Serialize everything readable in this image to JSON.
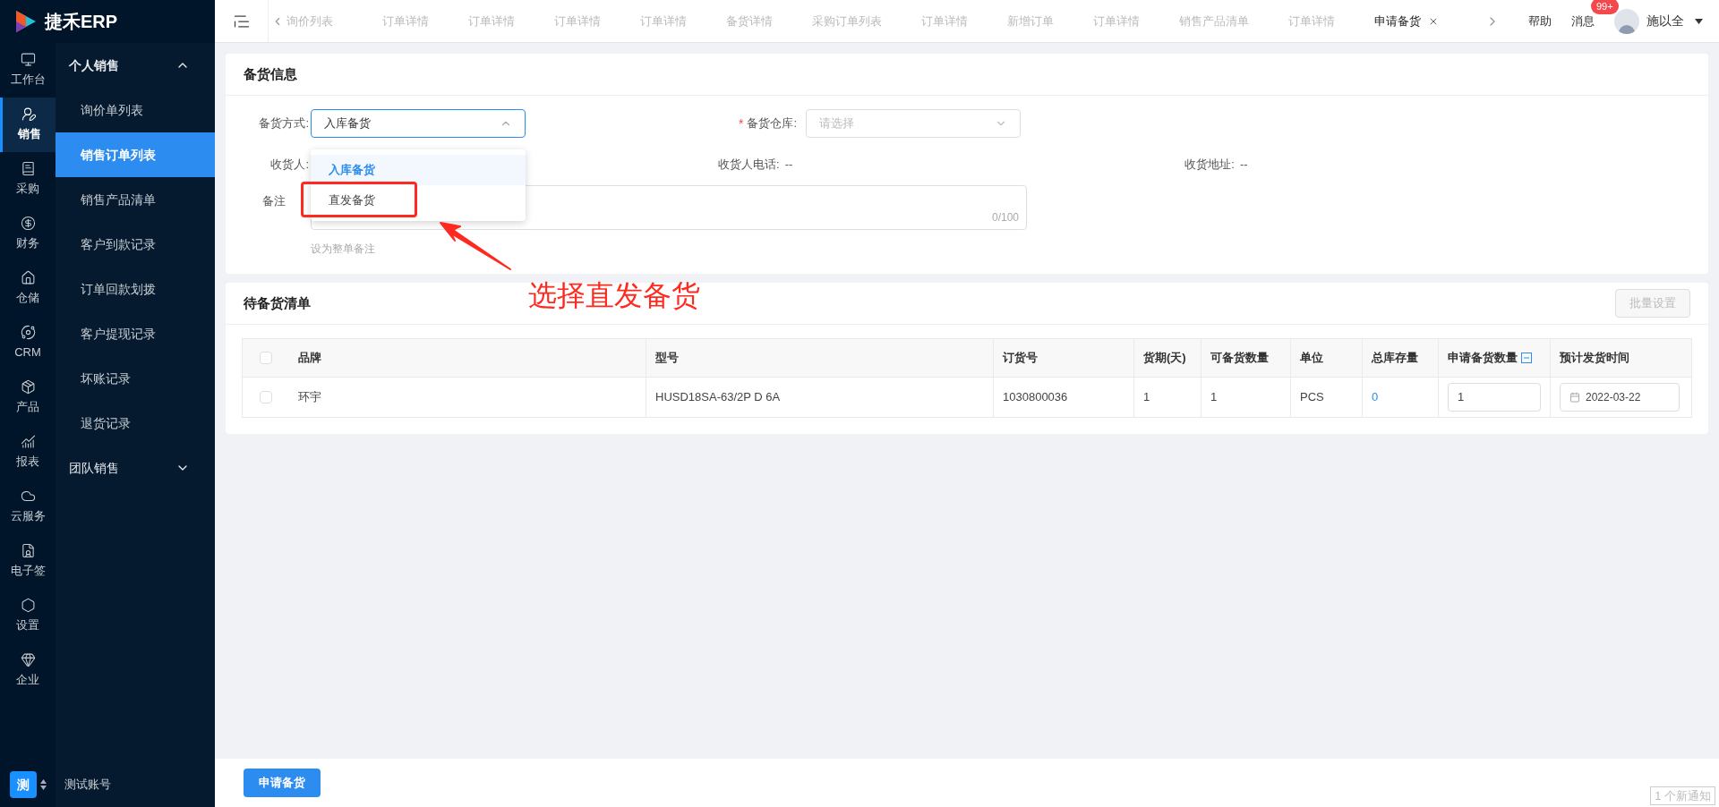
{
  "logo": {
    "text": "捷禾ERP"
  },
  "rail": [
    {
      "label": "工作台",
      "selected": false
    },
    {
      "label": "销售",
      "selected": true
    },
    {
      "label": "采购",
      "selected": false
    },
    {
      "label": "财务",
      "selected": false
    },
    {
      "label": "仓储",
      "selected": false
    },
    {
      "label": "CRM",
      "selected": false
    },
    {
      "label": "产品",
      "selected": false
    },
    {
      "label": "报表",
      "selected": false
    },
    {
      "label": "云服务",
      "selected": false
    },
    {
      "label": "电子签",
      "selected": false
    },
    {
      "label": "设置",
      "selected": false
    },
    {
      "label": "企业",
      "selected": false
    }
  ],
  "menu": [
    {
      "label": "个人销售",
      "expanded": true,
      "children": [
        {
          "label": "询价单列表",
          "selected": false
        },
        {
          "label": "销售订单列表",
          "selected": true
        },
        {
          "label": "销售产品清单",
          "selected": false
        },
        {
          "label": "客户到款记录",
          "selected": false
        },
        {
          "label": "订单回款划拨",
          "selected": false
        },
        {
          "label": "客户提现记录",
          "selected": false
        },
        {
          "label": "坏账记录",
          "selected": false
        },
        {
          "label": "退货记录",
          "selected": false
        }
      ]
    },
    {
      "label": "团队销售",
      "expanded": false
    }
  ],
  "account": {
    "badge": "测",
    "name": "测试账号"
  },
  "tabs": [
    {
      "label": "询价列表",
      "selected": false
    },
    {
      "label": "订单详情",
      "selected": false
    },
    {
      "label": "订单详情",
      "selected": false
    },
    {
      "label": "订单详情",
      "selected": false
    },
    {
      "label": "订单详情",
      "selected": false
    },
    {
      "label": "备货详情",
      "selected": false
    },
    {
      "label": "采购订单列表",
      "selected": false
    },
    {
      "label": "订单详情",
      "selected": false
    },
    {
      "label": "新增订单",
      "selected": false
    },
    {
      "label": "订单详情",
      "selected": false
    },
    {
      "label": "销售产品清单",
      "selected": false
    },
    {
      "label": "订单详情",
      "selected": false
    },
    {
      "label": "申请备货",
      "selected": true
    }
  ],
  "header": {
    "help": "帮助",
    "messages": "消息",
    "message_count": "99+",
    "user": "施以全"
  },
  "form": {
    "title": "备货信息",
    "method": {
      "label": "备货方式:",
      "value": "入库备货",
      "options": [
        {
          "label": "入库备货",
          "selected": true
        },
        {
          "label": "直发备货",
          "selected": false
        }
      ]
    },
    "warehouse": {
      "label": "备货仓库:",
      "placeholder": "请选择",
      "required_mark": "*"
    },
    "receiver": {
      "label": "收货人:"
    },
    "phone": {
      "label": "收货人电话:",
      "value": "--"
    },
    "address": {
      "label": "收货地址:",
      "value": "--"
    },
    "remark": {
      "label": "备注",
      "counter": "0/100",
      "hint": "设为整单备注"
    }
  },
  "annotation": {
    "text": "选择直发备货"
  },
  "list": {
    "title": "待备货清单",
    "batch_button": "批量设置",
    "select_all_checked": false,
    "columns": [
      "品牌",
      "型号",
      "订货号",
      "货期(天)",
      "可备货数量",
      "单位",
      "总库存量",
      "申请备货数量",
      "预计发货时间"
    ],
    "rows": [
      {
        "checked": false,
        "brand": "环宇",
        "model": "HUSD18SA-63/2P D 6A",
        "order_no": "1030800036",
        "lead_days": "1",
        "available": "1",
        "unit": "PCS",
        "stock": "0",
        "qty": "1",
        "date": "2022-03-22"
      }
    ]
  },
  "footer": {
    "submit": "申请备货",
    "notice": "1 个新通知"
  }
}
